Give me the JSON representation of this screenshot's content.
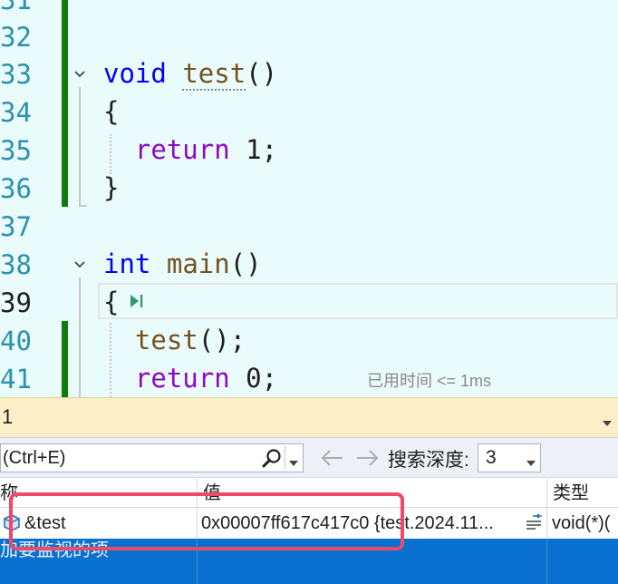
{
  "editor": {
    "line_numbers": [
      "31",
      "32",
      "33",
      "34",
      "35",
      "36",
      "37",
      "38",
      "39",
      "40",
      "41"
    ],
    "lines": {
      "l33": {
        "kw": "void",
        "fn": "test",
        "punct": "()"
      },
      "l34": {
        "text": "{"
      },
      "l35": {
        "ctl": "return",
        "rest": " 1;"
      },
      "l36": {
        "text": "}"
      },
      "l38": {
        "kw": "int",
        "fn": "main",
        "punct": "()"
      },
      "l39": {
        "text": "{"
      },
      "l40": {
        "fn": "test",
        "rest": "();"
      },
      "l41": {
        "ctl": "return",
        "rest": " 0;"
      }
    },
    "current_line": "39",
    "elapsed_hint": "已用时间 <= 1ms"
  },
  "watch": {
    "title": "1",
    "search_placeholder": "(Ctrl+E)",
    "depth_label": "搜索深度:",
    "depth_value": "3",
    "columns": {
      "name": "称",
      "value": "值",
      "type": "类型"
    },
    "rows": [
      {
        "name": "&test",
        "value": "0x00007ff617c417c0 {test.2024.11...",
        "type": "void(*)("
      }
    ],
    "add_item_hint": "加要监视的项"
  },
  "colors": {
    "editor_bg": "#eafbfb",
    "keyword": "#0000ff",
    "function": "#74531f",
    "control": "#8f08c4",
    "change_bar": "#107c10",
    "panel_title_bg": "#fcefc7",
    "selection": "#0a71d0",
    "annotation": "#ec4a68"
  }
}
